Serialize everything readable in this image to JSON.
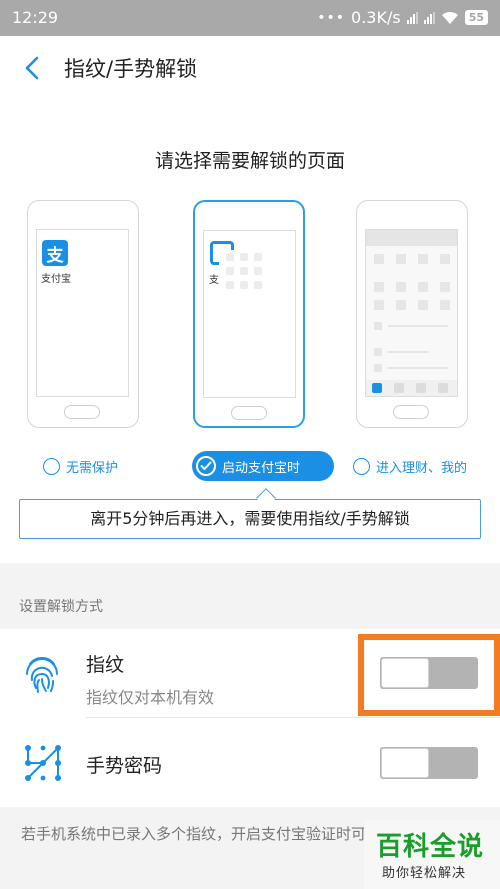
{
  "status_bar": {
    "time": "12:29",
    "dots": "•••",
    "speed": "0.3K/s",
    "battery": "55"
  },
  "header": {
    "title": "指纹/手势解锁"
  },
  "prompt": "请选择需要解锁的页面",
  "phones": {
    "alipay_label": "支付宝",
    "alipay_glyph": "支",
    "loading_fragment": "支"
  },
  "options": [
    {
      "label": "无需保护",
      "selected": false
    },
    {
      "label": "启动支付宝时",
      "selected": true
    },
    {
      "label": "进入理财、我的",
      "selected": false
    }
  ],
  "tooltip": "离开5分钟后再进入，需要使用指纹/手势解锁",
  "section_label": "设置解锁方式",
  "settings": [
    {
      "title": "指纹",
      "subtitle": "指纹仅对本机有效",
      "icon": "fingerprint-icon",
      "enabled": false
    },
    {
      "title": "手势密码",
      "icon": "gesture-pattern-icon",
      "enabled": false
    }
  ],
  "footnote": "若手机系统中已录入多个指纹，开启支付宝验证时可使用任意锁的指纹",
  "watermark": {
    "main": "百科全说",
    "sub": "助你轻松解决"
  },
  "colors": {
    "accent": "#1a8fe3",
    "highlight": "#f47b20",
    "watermark_green": "#1a9e2a"
  }
}
